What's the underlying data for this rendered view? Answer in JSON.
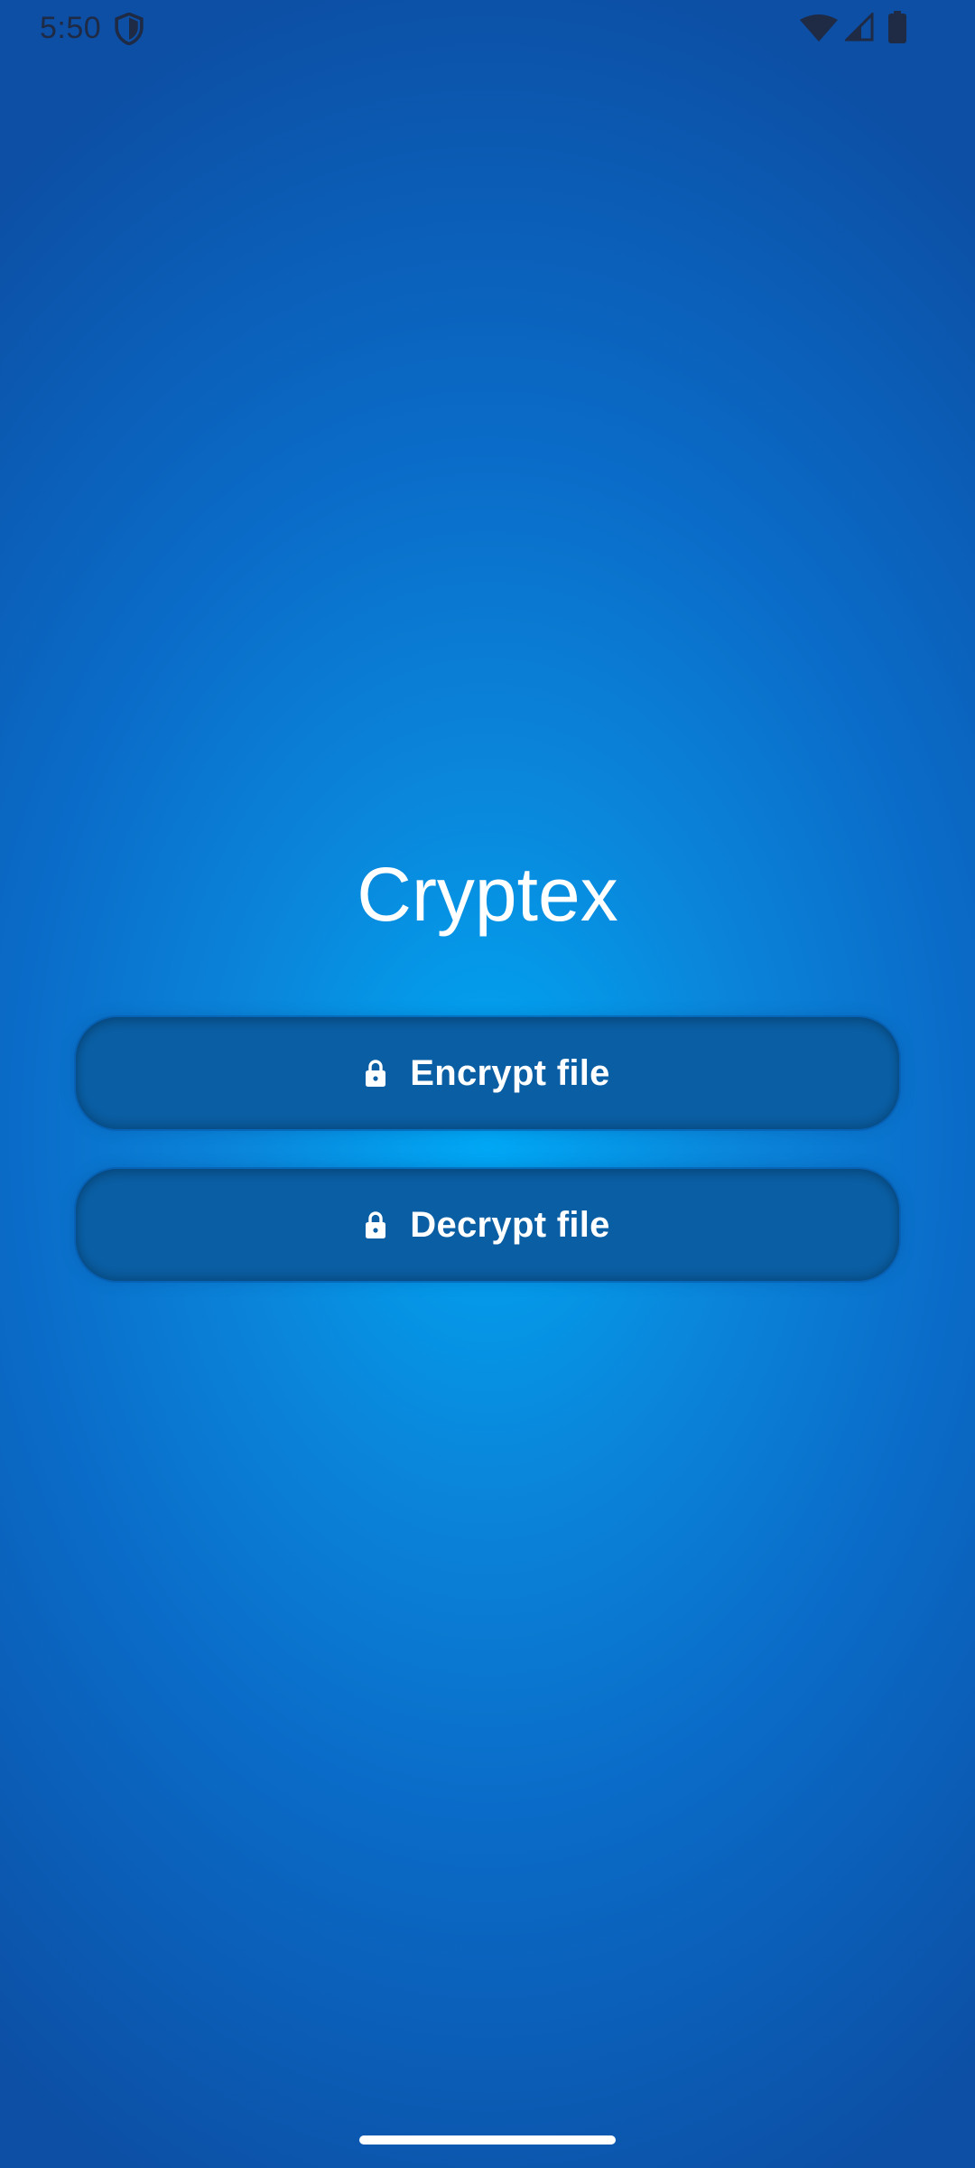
{
  "status_bar": {
    "time": "5:50",
    "icons": [
      "shield-icon",
      "wifi-icon",
      "signal-icon",
      "battery-icon"
    ]
  },
  "app": {
    "title": "Cryptex"
  },
  "actions": {
    "encrypt": {
      "label": "Encrypt file",
      "icon": "lock-icon"
    },
    "decrypt": {
      "label": "Decrypt file",
      "icon": "lock-icon"
    }
  },
  "colors": {
    "background_center": "#00a8f5",
    "background_edge": "#0c4fa5",
    "button": "#0a5ea3",
    "text": "#ffffff",
    "status_icons": "#1f2a44"
  }
}
